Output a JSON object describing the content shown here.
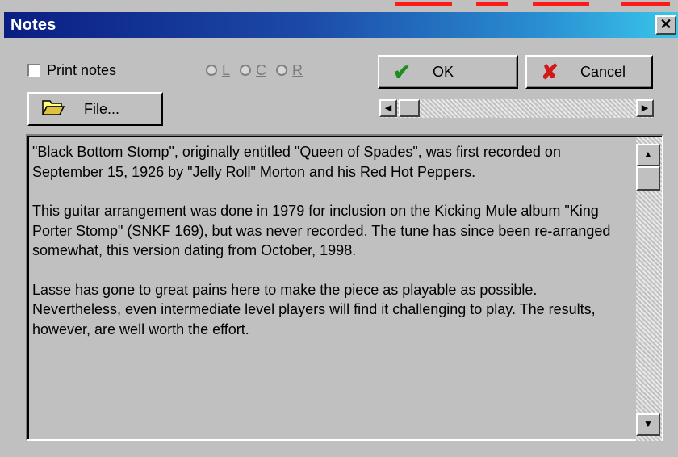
{
  "window": {
    "title": "Notes",
    "close_glyph": "✕"
  },
  "options": {
    "print_notes_label": "Print notes",
    "print_notes_checked": false,
    "alignment": [
      {
        "label": "L",
        "selected": false
      },
      {
        "label": "C",
        "selected": false
      },
      {
        "label": "R",
        "selected": false
      }
    ]
  },
  "buttons": {
    "ok_label": "OK",
    "cancel_label": "Cancel",
    "file_label": "File..."
  },
  "scrollbars": {
    "horizontal_left_glyph": "◀",
    "horizontal_right_glyph": "▶",
    "vertical_up_glyph": "▲",
    "vertical_down_glyph": "▼"
  },
  "notes": {
    "paragraphs": [
      "\"Black Bottom Stomp\", originally entitled  \"Queen of Spades\", was first recorded on September 15, 1926 by \"Jelly Roll\" Morton and his Red Hot Peppers.",
      "This guitar arrangement was done in 1979 for inclusion on the Kicking Mule album \"King Porter Stomp\" (SNKF 169), but was never recorded. The tune has since been re-arranged somewhat, this version dating from October, 1998.",
      "Lasse has gone to great pains here to make the piece as playable as possible. Nevertheless, even intermediate level players will find it challenging to play. The results, however, are well worth the effort."
    ]
  },
  "icons": {
    "ok": "check-icon",
    "cancel": "x-icon",
    "file": "folder-open-icon"
  },
  "colors": {
    "title_gradient_start": "#0a1e82",
    "title_gradient_end": "#39c7ea",
    "ok_check": "#1e8f1e",
    "cancel_x": "#d21818",
    "face": "#c0c0c0"
  }
}
